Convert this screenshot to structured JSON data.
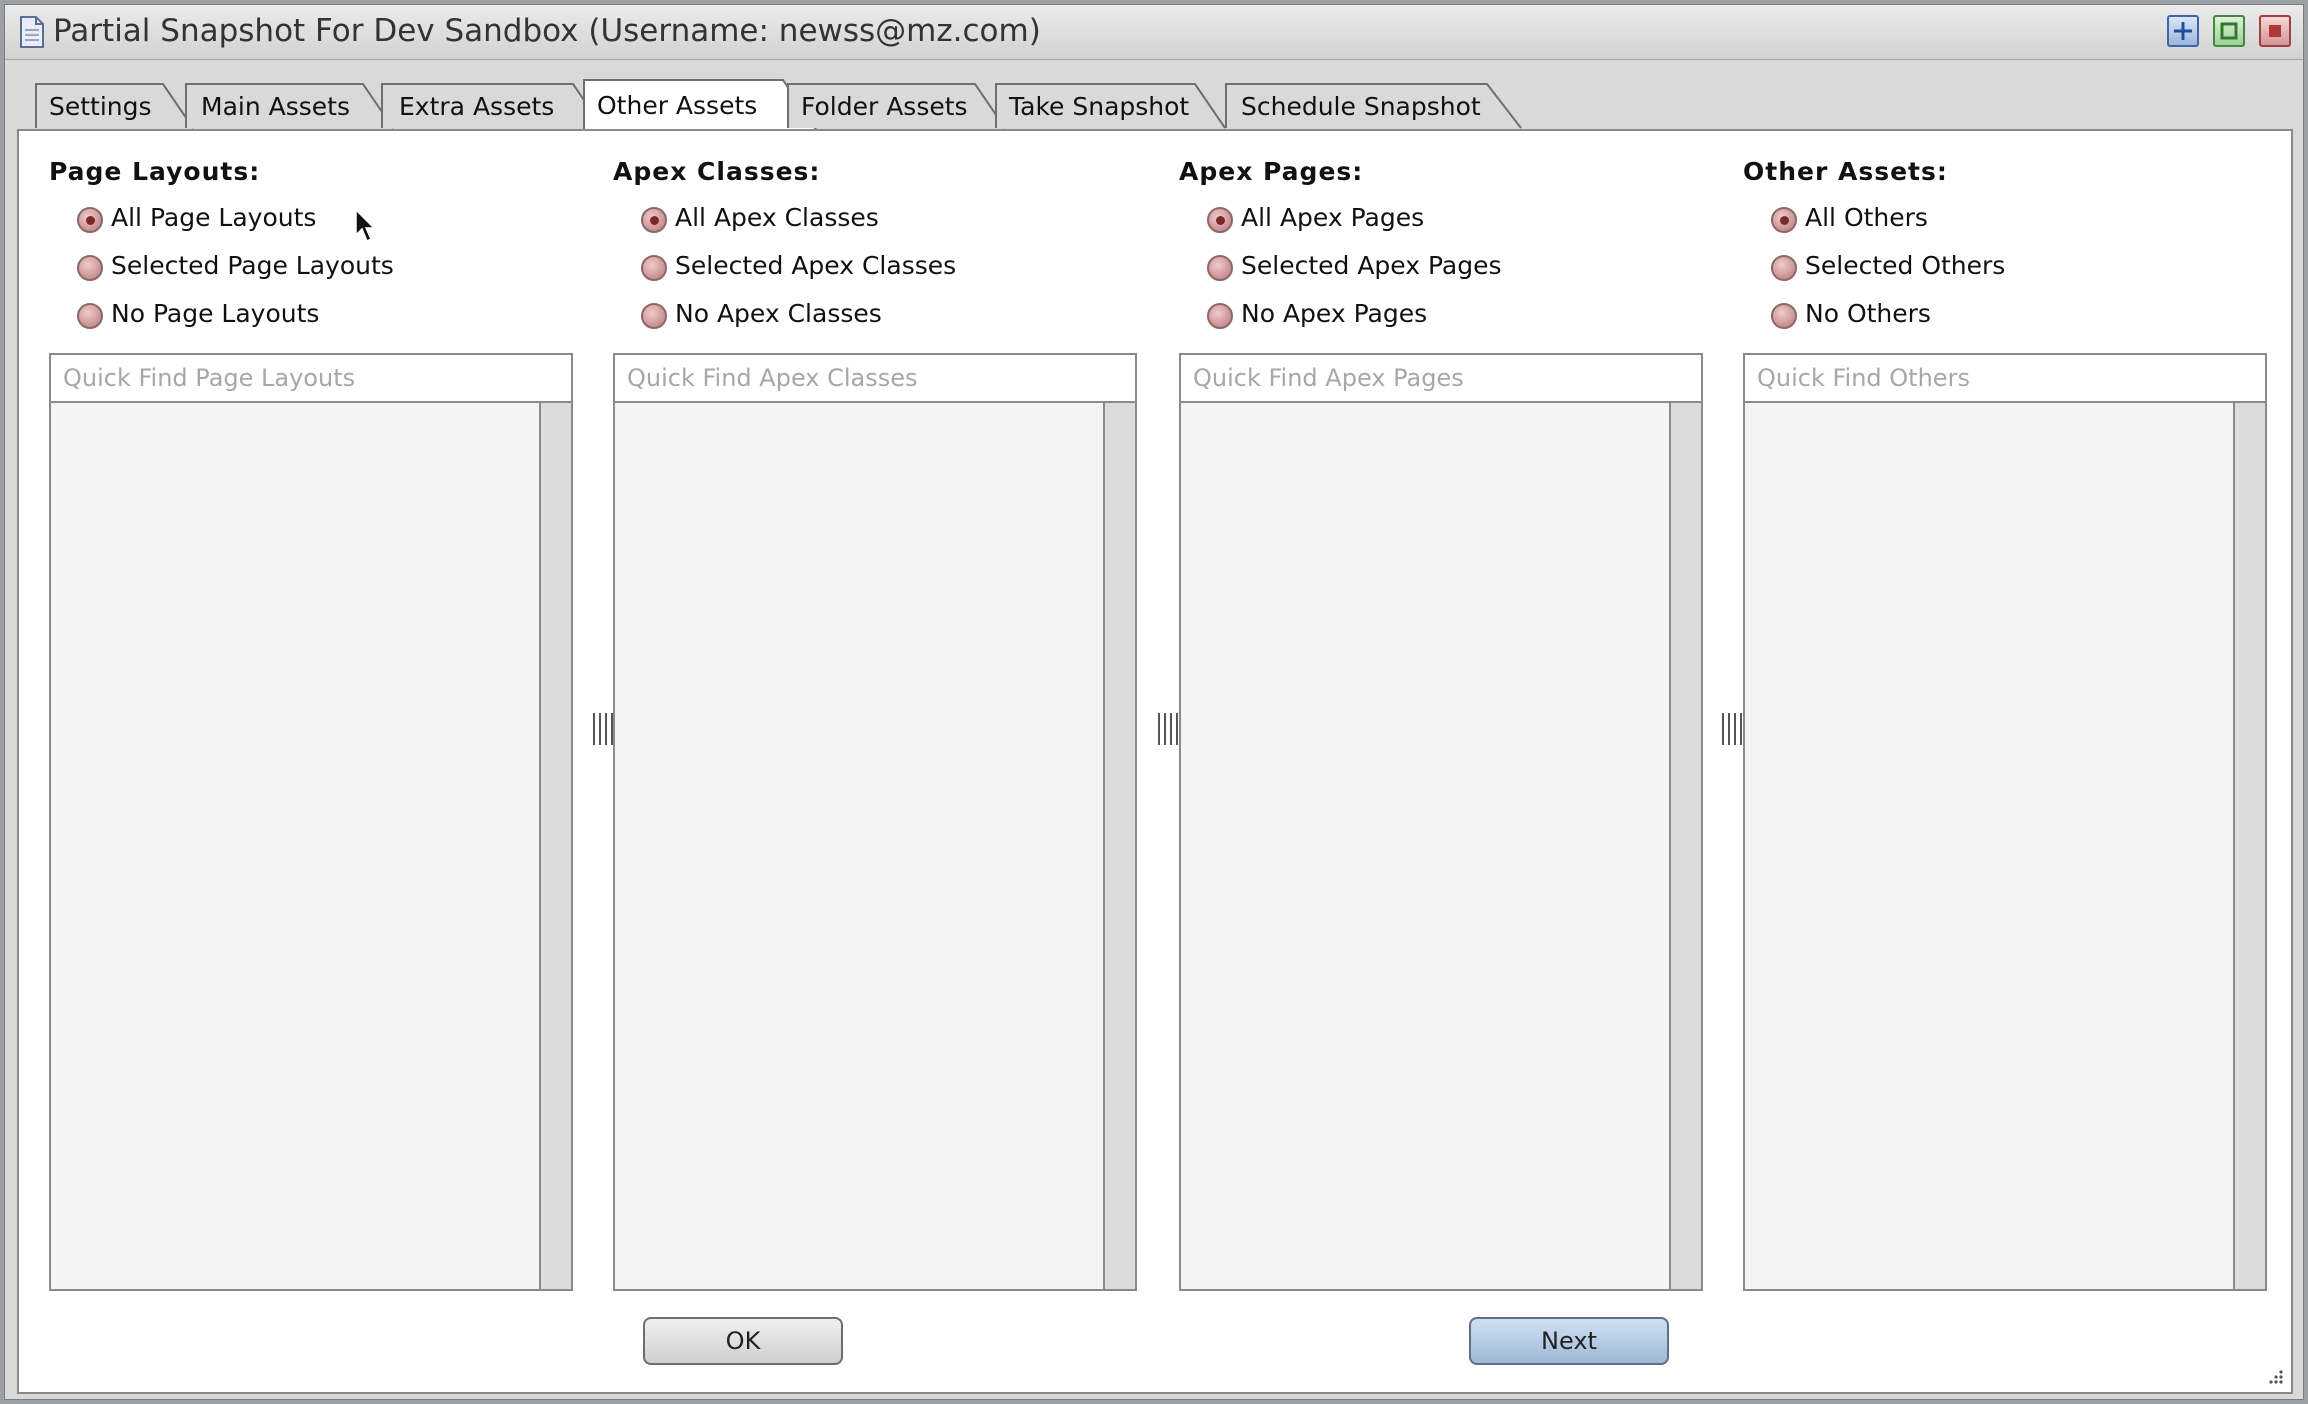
{
  "window": {
    "title": "Partial Snapshot For Dev Sandbox (Username: newss@mz.com)",
    "controls": [
      "add-icon",
      "maximize-icon",
      "close-icon"
    ]
  },
  "tabs": [
    {
      "label": "Settings",
      "active": false
    },
    {
      "label": "Main Assets",
      "active": false
    },
    {
      "label": "Extra Assets",
      "active": false
    },
    {
      "label": "Other Assets",
      "active": true
    },
    {
      "label": "Folder Assets",
      "active": false
    },
    {
      "label": "Take Snapshot",
      "active": false
    },
    {
      "label": "Schedule Snapshot",
      "active": false
    }
  ],
  "columns": [
    {
      "heading": "Page Layouts:",
      "options": [
        "All Page Layouts",
        "Selected Page Layouts",
        "No Page Layouts"
      ],
      "selected": 0,
      "search_placeholder": "Quick Find Page Layouts",
      "items": []
    },
    {
      "heading": "Apex Classes:",
      "options": [
        "All Apex Classes",
        "Selected Apex Classes",
        "No Apex Classes"
      ],
      "selected": 0,
      "search_placeholder": "Quick Find Apex Classes",
      "items": []
    },
    {
      "heading": "Apex Pages:",
      "options": [
        "All Apex Pages",
        "Selected Apex Pages",
        "No Apex Pages"
      ],
      "selected": 0,
      "search_placeholder": "Quick Find Apex Pages",
      "items": []
    },
    {
      "heading": "Other Assets:",
      "options": [
        "All Others",
        "Selected Others",
        "No Others"
      ],
      "selected": 0,
      "search_placeholder": "Quick Find Others",
      "items": []
    }
  ],
  "buttons": {
    "ok_label": "OK",
    "next_label": "Next"
  },
  "colors": {
    "radio_fill": "#c78d8d",
    "next_button": "#9fb8d6",
    "list_background": "#f4f4f4"
  }
}
